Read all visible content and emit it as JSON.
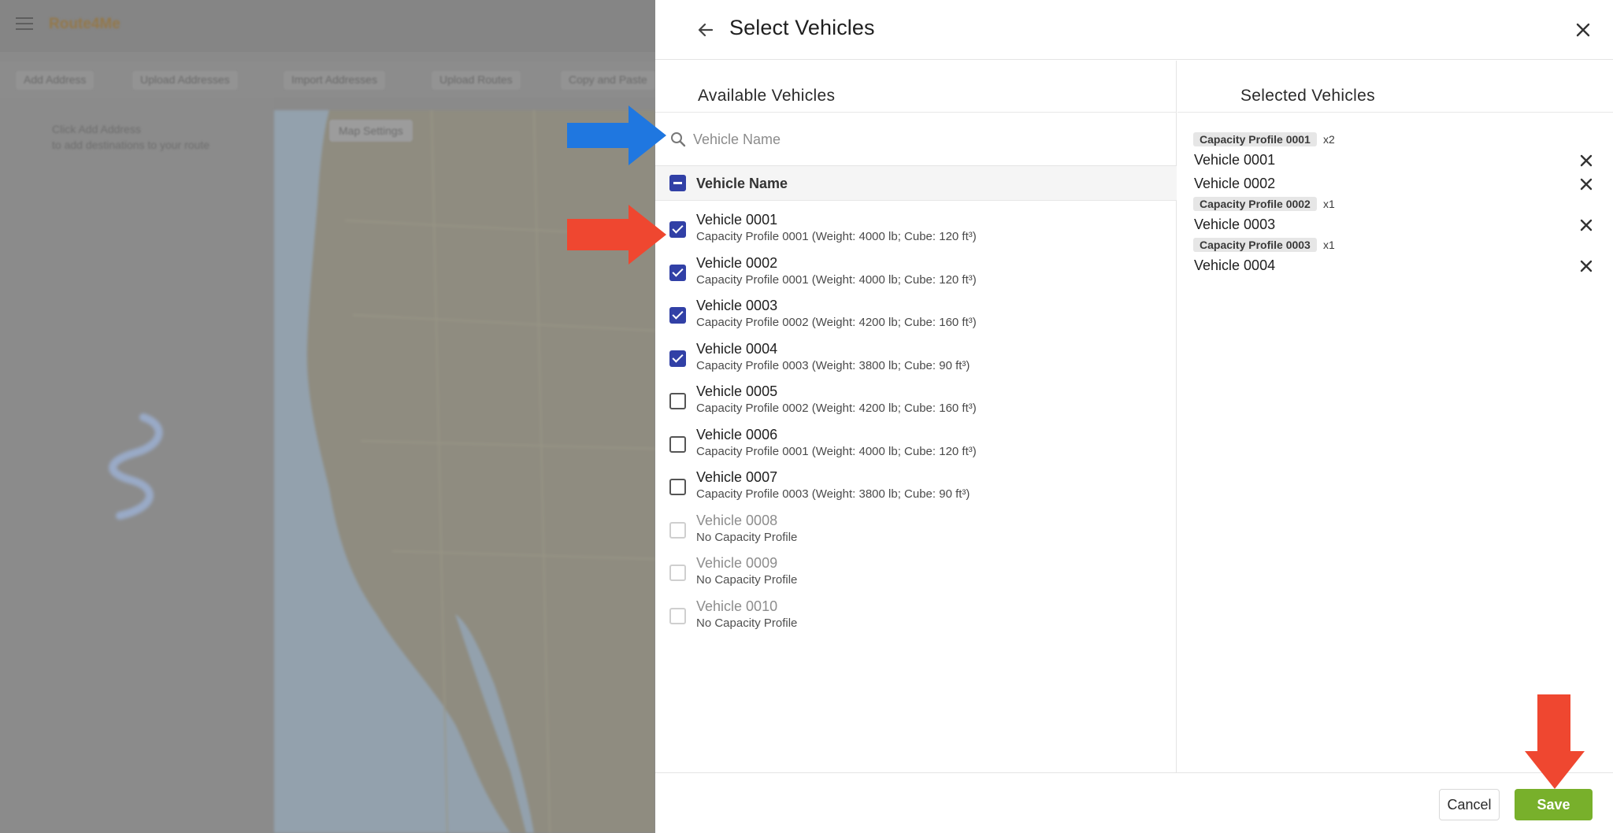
{
  "background": {
    "logo_text": "Route4Me",
    "toolbar": [
      "Add Address",
      "Upload Addresses",
      "Import Addresses",
      "Upload Routes",
      "Copy and Paste"
    ],
    "sidebar_hint_line1": "Click Add Address",
    "sidebar_hint_line2": "to add destinations to your route",
    "map_settings_label": "Map Settings"
  },
  "panel": {
    "title": "Select Vehicles",
    "back_icon": "arrow-left-icon",
    "close_icon": "close-icon"
  },
  "available": {
    "heading": "Available Vehicles",
    "search_placeholder": "Vehicle Name",
    "search_value": "",
    "column_header": "Vehicle Name",
    "select_all_state": "indeterminate",
    "vehicles": [
      {
        "name": "Vehicle 0001",
        "profile": "Capacity Profile 0001 (Weight: 4000 lb; Cube: 120 ft³)",
        "state": "checked"
      },
      {
        "name": "Vehicle 0002",
        "profile": "Capacity Profile 0001 (Weight: 4000 lb; Cube: 120 ft³)",
        "state": "checked"
      },
      {
        "name": "Vehicle 0003",
        "profile": "Capacity Profile 0002 (Weight: 4200 lb; Cube: 160 ft³)",
        "state": "checked"
      },
      {
        "name": "Vehicle 0004",
        "profile": "Capacity Profile 0003 (Weight: 3800 lb; Cube: 90 ft³)",
        "state": "checked"
      },
      {
        "name": "Vehicle 0005",
        "profile": "Capacity Profile 0002 (Weight: 4200 lb; Cube: 160 ft³)",
        "state": "unchecked"
      },
      {
        "name": "Vehicle 0006",
        "profile": "Capacity Profile 0001 (Weight: 4000 lb; Cube: 120 ft³)",
        "state": "unchecked"
      },
      {
        "name": "Vehicle 0007",
        "profile": "Capacity Profile 0003 (Weight: 3800 lb; Cube: 90 ft³)",
        "state": "unchecked"
      },
      {
        "name": "Vehicle 0008",
        "profile": "No Capacity Profile",
        "state": "disabled"
      },
      {
        "name": "Vehicle 0009",
        "profile": "No Capacity Profile",
        "state": "disabled"
      },
      {
        "name": "Vehicle 0010",
        "profile": "No Capacity Profile",
        "state": "disabled"
      }
    ]
  },
  "selected": {
    "heading": "Selected Vehicles",
    "groups": [
      {
        "profile": "Capacity Profile 0001",
        "count": "x2",
        "vehicles": [
          "Vehicle 0001",
          "Vehicle 0002"
        ]
      },
      {
        "profile": "Capacity Profile 0002",
        "count": "x1",
        "vehicles": [
          "Vehicle 0003"
        ]
      },
      {
        "profile": "Capacity Profile 0003",
        "count": "x1",
        "vehicles": [
          "Vehicle 0004"
        ]
      }
    ]
  },
  "footer": {
    "cancel_label": "Cancel",
    "save_label": "Save"
  },
  "colors": {
    "accent": "#3140a6",
    "save": "#78b02b",
    "arrow_blue": "#1f77e0",
    "arrow_red": "#ef4730"
  }
}
